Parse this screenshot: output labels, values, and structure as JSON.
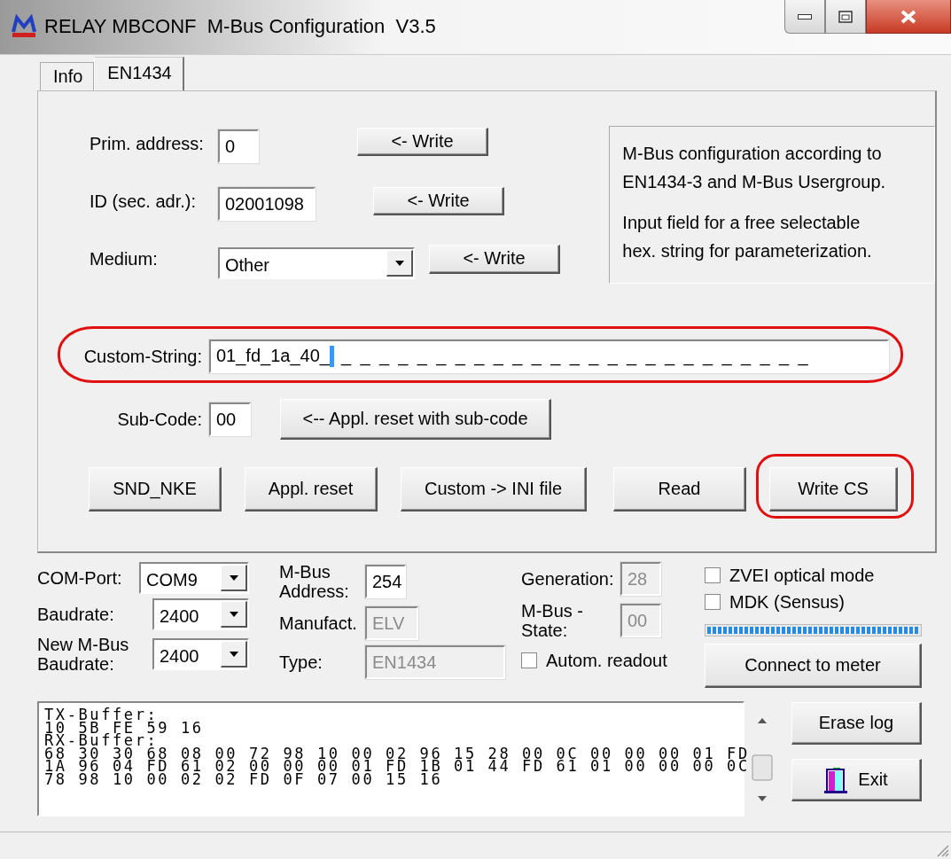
{
  "window": {
    "title": "RELAY MBCONF  M-Bus Configuration  V3.5"
  },
  "tabs": [
    {
      "label": "Info",
      "selected": false
    },
    {
      "label": "EN1434",
      "selected": true
    }
  ],
  "en1434": {
    "fields": [
      {
        "kind": "text",
        "label": "Prim. address:",
        "value": "0",
        "button": "<- Write"
      },
      {
        "kind": "text",
        "label": "ID (sec. adr.):",
        "value": "02001098",
        "button": "<- Write"
      },
      {
        "kind": "combo",
        "label": "Medium:",
        "value": "Other",
        "button": "<- Write"
      }
    ],
    "info": [
      "M-Bus configuration according to EN1434-3 and M-Bus Usergroup.",
      "Input field for a free selectable hex. string for parameterization."
    ],
    "custom_string": {
      "label": "Custom-String:",
      "value": "01_fd_1a_40_",
      "mask": "_ _ _ _ _ _ _ _ _ _ _ _ _ _ _ _ _ _ _ _ _ _ _ _ _",
      "highlighted": true
    },
    "sub_code": {
      "label": "Sub-Code:",
      "value": "00",
      "button": "<-- Appl. reset with sub-code"
    },
    "actions": [
      {
        "label": "SND_NKE",
        "highlighted": false
      },
      {
        "label": "Appl. reset",
        "highlighted": false
      },
      {
        "label": "Custom -> INI file",
        "highlighted": false
      },
      {
        "label": "Read",
        "highlighted": false
      },
      {
        "label": "Write CS",
        "highlighted": true
      }
    ]
  },
  "connection": {
    "port": [
      {
        "label": "COM-Port:",
        "value": "COM9"
      },
      {
        "label": "Baudrate:",
        "value": "2400"
      },
      {
        "label": "New M-Bus Baudrate:",
        "value": "2400"
      }
    ],
    "meter": [
      {
        "label": "M-Bus Address:",
        "value": "254",
        "disabled": false
      },
      {
        "label": "Manufact.",
        "value": "ELV",
        "disabled": true
      },
      {
        "label": "Type:",
        "value": "EN1434",
        "disabled": true
      }
    ],
    "status": [
      {
        "label": "Generation:",
        "value": "28",
        "disabled": true
      },
      {
        "label": "M-Bus - State:",
        "value": "00",
        "disabled": true
      }
    ],
    "autom_readout": {
      "label": "Autom. readout",
      "checked": false
    },
    "options": [
      {
        "label": "ZVEI optical mode",
        "checked": false
      },
      {
        "label": "MDK (Sensus)",
        "checked": false
      }
    ],
    "progress": {
      "level": 1
    },
    "connect_button": "Connect to meter"
  },
  "log": {
    "lines": [
      "TX-Buffer:",
      "10 5B FE 59 16",
      "RX-Buffer:",
      "68 30 30 68 08 00 72 98 10 00 02 96 15 28 00 0C 00 00 00 01 FD",
      "1A 96 04 FD 61 02 00 00 00 01 FD 1B 01 44 FD 61 01 00 00 00 0C",
      "78 98 10 00 02 02 FD 0F 07 00 15 16"
    ]
  },
  "log_buttons": [
    {
      "kind": "text",
      "label": "Erase log"
    },
    {
      "kind": "exit",
      "label": "Exit"
    }
  ]
}
